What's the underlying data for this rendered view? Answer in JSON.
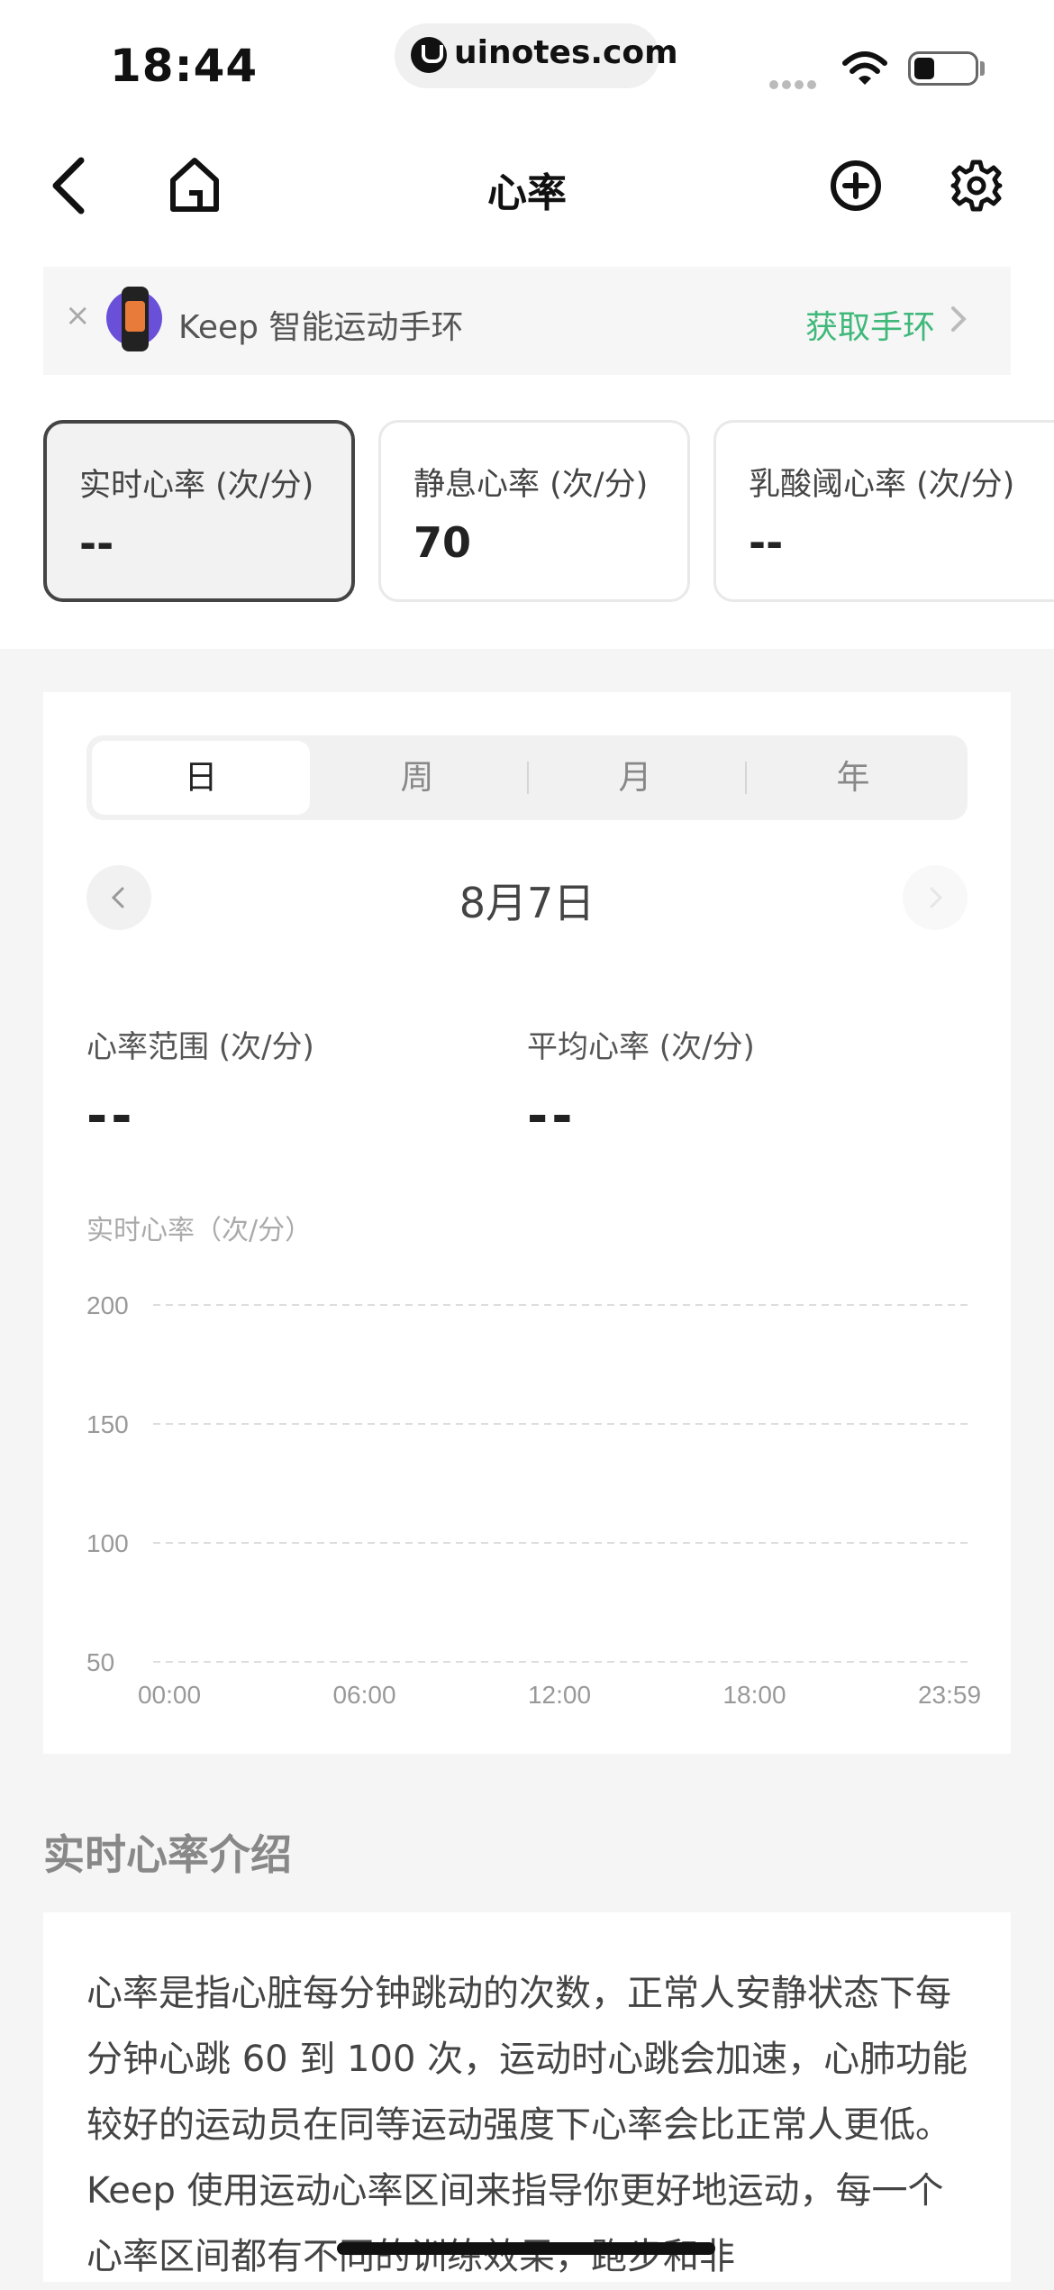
{
  "status_bar": {
    "time": "18:44",
    "url": "uinotes.com"
  },
  "nav": {
    "title": "心率"
  },
  "promo": {
    "close": "×",
    "text": "Keep 智能运动手环",
    "link": "获取手环"
  },
  "metrics": [
    {
      "label": "实时心率 (次/分)",
      "value": "--",
      "active": true
    },
    {
      "label": "静息心率 (次/分)",
      "value": "70",
      "active": false
    },
    {
      "label": "乳酸阈心率 (次/分)",
      "value": "--",
      "active": false
    }
  ],
  "tabs": [
    {
      "label": "日",
      "active": true
    },
    {
      "label": "周",
      "active": false
    },
    {
      "label": "月",
      "active": false
    },
    {
      "label": "年",
      "active": false
    }
  ],
  "date_nav": {
    "date": "8月7日"
  },
  "stats": {
    "range_label": "心率范围 (次/分)",
    "range_value": "--",
    "avg_label": "平均心率 (次/分)",
    "avg_value": "--"
  },
  "chart_data": {
    "type": "line",
    "title": "实时心率（次/分）",
    "x_ticks": [
      "00:00",
      "06:00",
      "12:00",
      "18:00",
      "23:59"
    ],
    "y_ticks": [
      200,
      150,
      100,
      50
    ],
    "ylim": [
      50,
      200
    ],
    "grid": true,
    "series": []
  },
  "intro": {
    "heading": "实时心率介绍",
    "body": "心率是指心脏每分钟跳动的次数，正常人安静状态下每分钟心跳 60 到 100 次，运动时心跳会加速，心肺功能较好的运动员在同等运动强度下心率会比正常人更低。 Keep 使用运动心率区间来指导你更好地运动，每一个心率区间都有不同的训练效果，跑步和非"
  },
  "colors": {
    "accent_green": "#3fb87a",
    "active_border": "#444444"
  }
}
